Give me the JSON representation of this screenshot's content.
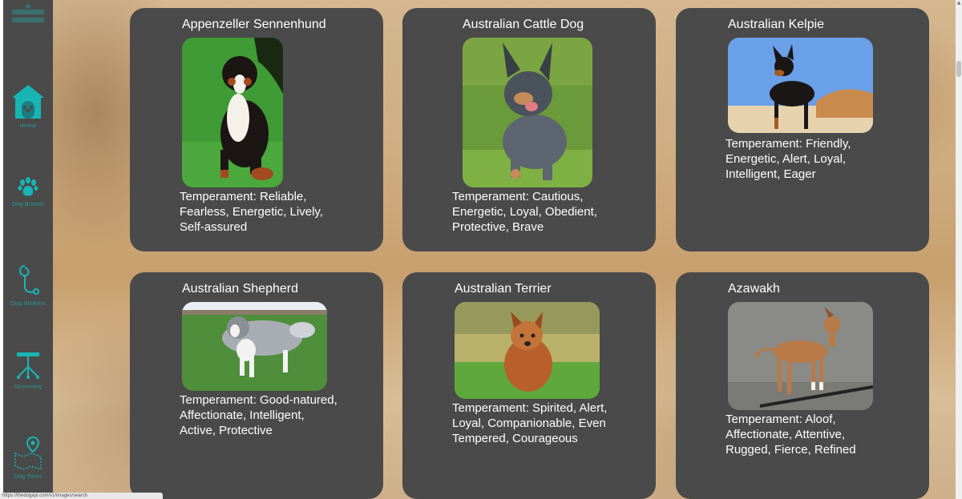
{
  "sidebar": {
    "items": [
      {
        "icon": "dog-house-icon",
        "label": "Home"
      },
      {
        "icon": "paw-icon",
        "label": "Dog Breeds"
      },
      {
        "icon": "leash-icon",
        "label": "Dog Walkers"
      },
      {
        "icon": "grooming-table-icon",
        "label": "Grooming"
      },
      {
        "icon": "map-pin-icon",
        "label": "Dog Parks"
      }
    ]
  },
  "breeds": [
    {
      "name": "Appenzeller Sennenhund",
      "temperament": "Temperament: Reliable, Fearless, Energetic, Lively, Self-assured"
    },
    {
      "name": "Australian Cattle Dog",
      "temperament": "Temperament: Cautious, Energetic, Loyal, Obedient, Protective, Brave"
    },
    {
      "name": "Australian Kelpie",
      "temperament": "Temperament: Friendly, Energetic, Alert, Loyal, Intelligent, Eager"
    },
    {
      "name": "Australian Shepherd",
      "temperament": "Temperament: Good-natured, Affectionate, Intelligent, Active, Protective"
    },
    {
      "name": "Australian Terrier",
      "temperament": "Temperament: Spirited, Alert, Loyal, Companionable, Even Tempered, Courageous"
    },
    {
      "name": "Azawakh",
      "temperament": "Temperament: Aloof, Affectionate, Attentive, Rugged, Fierce, Refined"
    }
  ],
  "colors": {
    "accent": "#19b5b5",
    "card_bg": "#4a4a4a",
    "sidebar_bg": "#4a4a4a"
  },
  "status_bar": {
    "url": "https://thedogapi.com/v1/images/search"
  }
}
